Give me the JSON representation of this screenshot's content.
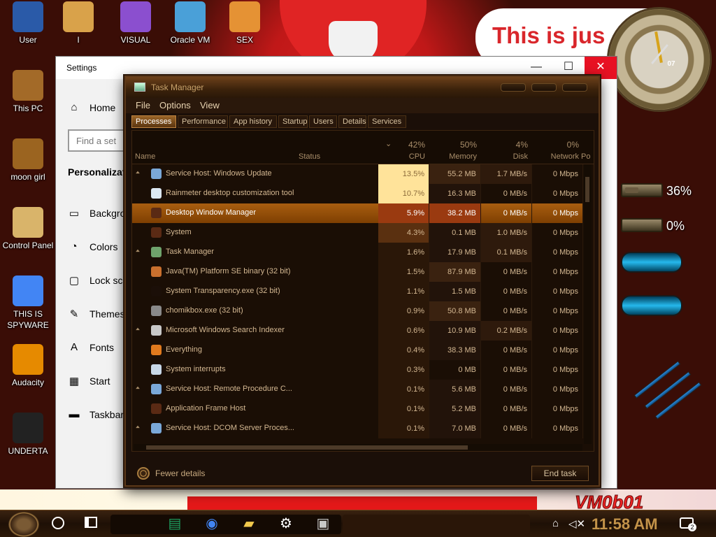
{
  "desktop": {
    "headline": "This is jus",
    "watermark": "VM0b01",
    "icons": [
      {
        "label": "User",
        "color": "#2a5aa8"
      },
      {
        "label": "I",
        "color": "#d9a24a"
      },
      {
        "label": "VISUAL",
        "color": "#8b4fcf"
      },
      {
        "label": "Oracle VM",
        "color": "#4aa0d8"
      },
      {
        "label": "SEX",
        "color": "#e59234"
      },
      {
        "label": "This PC",
        "color": "#a36a28"
      },
      {
        "label": "moon girl",
        "color": "#9b6420"
      },
      {
        "label": "Control Panel",
        "color": "#d9b46a"
      },
      {
        "label": "THIS IS SPYWARE",
        "color": "#4285f4"
      },
      {
        "label": "Audacity",
        "color": "#e68a00"
      },
      {
        "label": "UNDERTA",
        "color": "#222222"
      }
    ],
    "clock_number": "07",
    "meters": [
      {
        "percent": "36%",
        "fill": 0.36,
        "color": "#6a5a40"
      },
      {
        "percent": "0%",
        "fill": 0.0,
        "color": "#3fbb43"
      }
    ]
  },
  "settings": {
    "title": "Settings",
    "home": "Home",
    "search_placeholder": "Find a set",
    "section": "Personalizati",
    "nav": [
      "Backgrou",
      "Colors",
      "Lock scre",
      "Themes",
      "Fonts",
      "Start",
      "Taskbar"
    ],
    "icons": [
      "picture-icon",
      "palette-icon",
      "lock-screen-icon",
      "themes-icon",
      "fonts-icon",
      "start-icon",
      "taskbar-icon"
    ],
    "minimize": "—",
    "maximize": "☐",
    "close": "✕"
  },
  "taskmanager": {
    "title": "Task Manager",
    "menu": [
      "File",
      "Options",
      "View"
    ],
    "tabs": [
      "Processes",
      "Performance",
      "App history",
      "Startup",
      "Users",
      "Details",
      "Services"
    ],
    "active_tab": "Processes",
    "columns": {
      "name": "Name",
      "status": "Status",
      "cpu_pct": "42%",
      "cpu": "CPU",
      "mem_pct": "50%",
      "memory": "Memory",
      "disk_pct": "4%",
      "disk": "Disk",
      "net_pct": "0%",
      "network": "Network",
      "power": "Po"
    },
    "processes": [
      {
        "name": "Service Host: Windows Update",
        "cpu": "13.5%",
        "memory": "55.2 MB",
        "disk": "1.7 MB/s",
        "network": "0 Mbps",
        "expandable": true,
        "icon_color": "#7aa8d8"
      },
      {
        "name": "Rainmeter desktop customization tool",
        "cpu": "10.7%",
        "memory": "16.3 MB",
        "disk": "0 MB/s",
        "network": "0 Mbps",
        "expandable": false,
        "icon_color": "#dce8f2"
      },
      {
        "name": "Desktop Window Manager",
        "cpu": "5.9%",
        "memory": "38.2 MB",
        "disk": "0 MB/s",
        "network": "0 Mbps",
        "expandable": false,
        "icon_color": "#5a2a14",
        "selected": true
      },
      {
        "name": "System",
        "cpu": "4.3%",
        "memory": "0.1 MB",
        "disk": "1.0 MB/s",
        "network": "0 Mbps",
        "expandable": false,
        "icon_color": "#5a2a14"
      },
      {
        "name": "Task Manager",
        "cpu": "1.6%",
        "memory": "17.9 MB",
        "disk": "0.1 MB/s",
        "network": "0 Mbps",
        "expandable": true,
        "icon_color": "#6fa36c"
      },
      {
        "name": "Java(TM) Platform SE binary (32 bit)",
        "cpu": "1.5%",
        "memory": "87.9 MB",
        "disk": "0 MB/s",
        "network": "0 Mbps",
        "expandable": false,
        "icon_color": "#c9702e"
      },
      {
        "name": "System Transparency.exe (32 bit)",
        "cpu": "1.1%",
        "memory": "1.5 MB",
        "disk": "0 MB/s",
        "network": "0 Mbps",
        "expandable": false,
        "icon_color": "#1b0f08"
      },
      {
        "name": "chomikbox.exe (32 bit)",
        "cpu": "0.9%",
        "memory": "50.8 MB",
        "disk": "0 MB/s",
        "network": "0 Mbps",
        "expandable": false,
        "icon_color": "#8a8a8a"
      },
      {
        "name": "Microsoft Windows Search Indexer",
        "cpu": "0.6%",
        "memory": "10.9 MB",
        "disk": "0.2 MB/s",
        "network": "0 Mbps",
        "expandable": true,
        "icon_color": "#c8c8c8"
      },
      {
        "name": "Everything",
        "cpu": "0.4%",
        "memory": "38.3 MB",
        "disk": "0 MB/s",
        "network": "0 Mbps",
        "expandable": false,
        "icon_color": "#e07a1e"
      },
      {
        "name": "System interrupts",
        "cpu": "0.3%",
        "memory": "0 MB",
        "disk": "0 MB/s",
        "network": "0 Mbps",
        "expandable": false,
        "icon_color": "#c8d8e8"
      },
      {
        "name": "Service Host: Remote Procedure C...",
        "cpu": "0.1%",
        "memory": "5.6 MB",
        "disk": "0 MB/s",
        "network": "0 Mbps",
        "expandable": true,
        "icon_color": "#7aa8d8"
      },
      {
        "name": "Application Frame Host",
        "cpu": "0.1%",
        "memory": "5.2 MB",
        "disk": "0 MB/s",
        "network": "0 Mbps",
        "expandable": false,
        "icon_color": "#5a2a14"
      },
      {
        "name": "Service Host: DCOM Server Proces...",
        "cpu": "0.1%",
        "memory": "7.0 MB",
        "disk": "0 MB/s",
        "network": "0 Mbps",
        "expandable": true,
        "icon_color": "#7aa8d8"
      }
    ],
    "fewer_details": "Fewer details",
    "end_task": "End task"
  },
  "taskbar": {
    "time": "11:58 AM",
    "notification_count": "2",
    "pinned": [
      {
        "name": "sheets-icon",
        "color": "#1ea362"
      },
      {
        "name": "chrome-icon",
        "color": "#4285f4"
      },
      {
        "name": "file-explorer-icon",
        "color": "#f2c94c"
      },
      {
        "name": "settings-icon",
        "color": "#ffffff"
      },
      {
        "name": "task-manager-icon",
        "color": "#c8c8c8"
      }
    ]
  }
}
